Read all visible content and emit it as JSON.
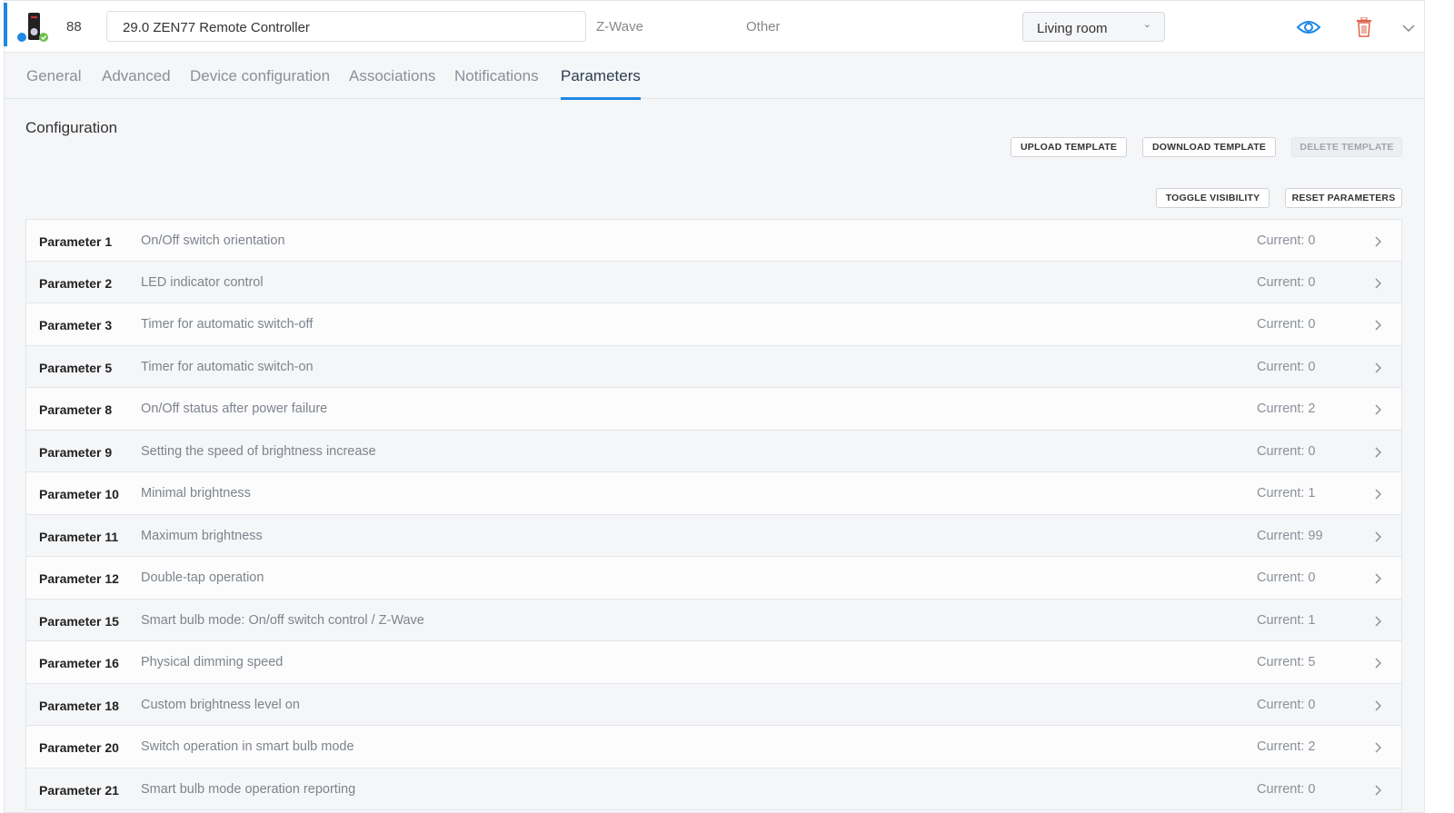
{
  "header": {
    "node_id": "88",
    "device_name": "29.0 ZEN77 Remote Controller",
    "protocol": "Z-Wave",
    "category": "Other",
    "room": "Living room"
  },
  "tabs": [
    "General",
    "Advanced",
    "Device configuration",
    "Associations",
    "Notifications",
    "Parameters"
  ],
  "active_tab": "Parameters",
  "section_title": "Configuration",
  "buttons": {
    "upload": "UPLOAD TEMPLATE",
    "download": "DOWNLOAD TEMPLATE",
    "delete": "DELETE TEMPLATE",
    "toggle": "TOGGLE VISIBILITY",
    "reset": "RESET PARAMETERS"
  },
  "parameters": [
    {
      "name": "Parameter 1",
      "desc": "On/Off switch orientation",
      "current": "Current: 0"
    },
    {
      "name": "Parameter 2",
      "desc": "LED indicator control",
      "current": "Current: 0"
    },
    {
      "name": "Parameter 3",
      "desc": "Timer for automatic switch-off",
      "current": "Current: 0"
    },
    {
      "name": "Parameter 5",
      "desc": "Timer for automatic switch-on",
      "current": "Current: 0"
    },
    {
      "name": "Parameter 8",
      "desc": "On/Off status after power failure",
      "current": "Current: 2"
    },
    {
      "name": "Parameter 9",
      "desc": "Setting the speed of brightness increase",
      "current": "Current: 0"
    },
    {
      "name": "Parameter 10",
      "desc": "Minimal brightness",
      "current": "Current: 1"
    },
    {
      "name": "Parameter 11",
      "desc": "Maximum brightness",
      "current": "Current: 99"
    },
    {
      "name": "Parameter 12",
      "desc": "Double-tap operation",
      "current": "Current: 0"
    },
    {
      "name": "Parameter 15",
      "desc": "Smart bulb mode: On/off switch control / Z-Wave",
      "current": "Current: 1"
    },
    {
      "name": "Parameter 16",
      "desc": "Physical dimming speed",
      "current": "Current: 5"
    },
    {
      "name": "Parameter 18",
      "desc": "Custom brightness level on",
      "current": "Current: 0"
    },
    {
      "name": "Parameter 20",
      "desc": "Switch operation in smart bulb mode",
      "current": "Current: 2"
    },
    {
      "name": "Parameter 21",
      "desc": "Smart bulb mode operation reporting",
      "current": "Current: 0"
    }
  ],
  "colors": {
    "accent": "#1e88e5",
    "delete": "#e0604a",
    "ok": "#6cc04a"
  }
}
